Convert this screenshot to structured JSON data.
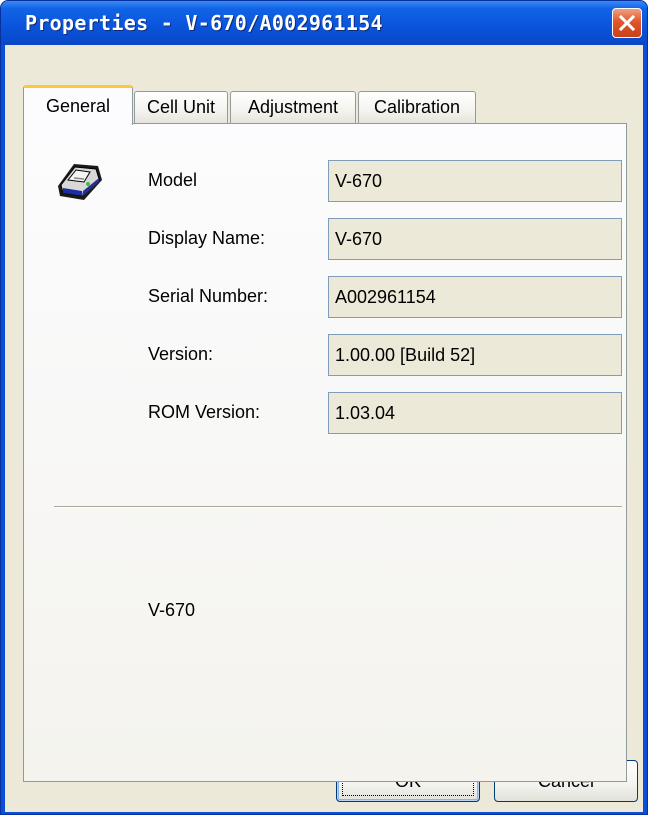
{
  "window": {
    "title": "Properties - V-670/A002961154"
  },
  "tabs": [
    {
      "label": "General",
      "active": true
    },
    {
      "label": "Cell Unit",
      "active": false
    },
    {
      "label": "Adjustment",
      "active": false
    },
    {
      "label": "Calibration",
      "active": false
    }
  ],
  "general": {
    "device_icon": "spectrophotometer-icon",
    "fields": [
      {
        "label": "Model",
        "value": "V-670"
      },
      {
        "label": "Display Name:",
        "value": "V-670"
      },
      {
        "label": "Serial Number:",
        "value": "A002961154"
      },
      {
        "label": "Version:",
        "value": "1.00.00 [Build 52]"
      },
      {
        "label": "ROM Version:",
        "value": "1.03.04"
      }
    ],
    "description": "V-670"
  },
  "buttons": {
    "ok_label": "OK",
    "cancel_label": "Cancel"
  },
  "colors": {
    "titlebar": "#0a55dc",
    "close_button": "#e0572b",
    "dialog_background": "#ece9d8",
    "active_tab_highlight": "#ffc83c"
  }
}
